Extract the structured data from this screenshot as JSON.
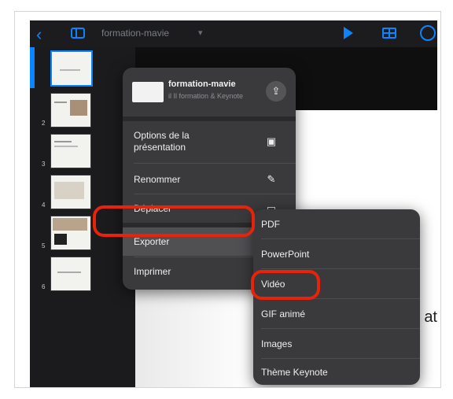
{
  "toolbar": {
    "back_icon": "chevron-left-icon",
    "doc_title": "formation-mavie",
    "doc_title_chevron": "▾"
  },
  "navigator": {
    "slide_numbers": [
      "2",
      "3",
      "4",
      "5",
      "6"
    ]
  },
  "slide": {
    "partial_text": "at"
  },
  "share_menu": {
    "doc_name": "formation-mavie",
    "doc_subtitle": "il Il formation & Keynote",
    "share_button_icon": "share-icon",
    "items": [
      {
        "label": "Options de la présentation",
        "icon": "presentation-options-icon"
      },
      {
        "label": "Renommer",
        "icon": "pencil-icon"
      },
      {
        "label": "Déplacer",
        "icon": "folder-icon"
      },
      {
        "label": "Exporter",
        "icon": "export-icon"
      },
      {
        "label": "Imprimer",
        "icon": "printer-icon"
      }
    ]
  },
  "export_submenu": {
    "items": [
      "PDF",
      "PowerPoint",
      "Vidéo",
      "GIF animé",
      "Images",
      "Thème Keynote"
    ]
  },
  "colors": {
    "accent": "#0a84ff",
    "annotation": "#e8230a",
    "menu_bg": "#3a3a3c"
  }
}
